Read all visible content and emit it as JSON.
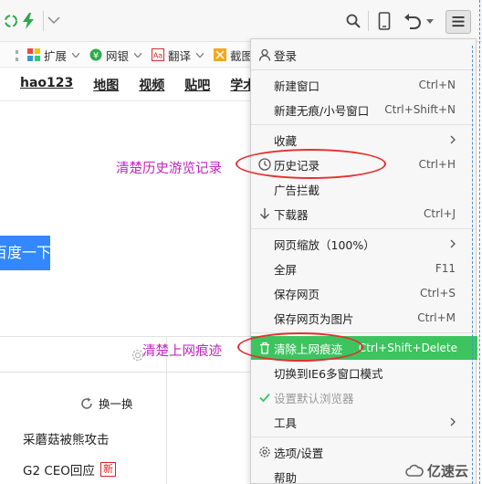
{
  "toolbar": {
    "refresh_icon": "refresh-icon",
    "accelerate_icon": "lightning-icon",
    "search_icon": "search-icon",
    "device_icon": "phone-icon",
    "undo_icon": "undo-icon",
    "menu_icon": "hamburger-menu-icon"
  },
  "bookmarks": [
    {
      "label": "扩展",
      "icon": "extension-icon"
    },
    {
      "label": "网银",
      "icon": "yen-icon"
    },
    {
      "label": "翻译",
      "icon": "translate-icon"
    },
    {
      "label": "截图",
      "icon": "screenshot-icon"
    }
  ],
  "nav": [
    "hao123",
    "地图",
    "视频",
    "贴吧",
    "学术"
  ],
  "search_button": "百度一下",
  "annotations": {
    "history": "清楚历史游览记录",
    "clear": "清楚上网痕迹"
  },
  "panel": {
    "refresh_label": "换一换",
    "news": [
      "采蘑菇被熊攻击",
      "G2 CEO回应"
    ],
    "new_badge": "新"
  },
  "menu": {
    "items": [
      {
        "key": "login",
        "label": "登录",
        "shortcut": ""
      },
      {
        "key": "new_window",
        "label": "新建窗口",
        "shortcut": "Ctrl+N"
      },
      {
        "key": "new_incognito",
        "label": "新建无痕/小号窗口",
        "shortcut": "Ctrl+Shift+N"
      },
      {
        "key": "favorites",
        "label": "收藏",
        "shortcut": ""
      },
      {
        "key": "history",
        "label": "历史记录",
        "shortcut": "Ctrl+H"
      },
      {
        "key": "adblock",
        "label": "广告拦截",
        "shortcut": ""
      },
      {
        "key": "downloads",
        "label": "下载器",
        "shortcut": "Ctrl+J"
      },
      {
        "key": "zoom",
        "label": "网页缩放（100%）",
        "shortcut": ""
      },
      {
        "key": "fullscreen",
        "label": "全屏",
        "shortcut": "F11"
      },
      {
        "key": "save_page",
        "label": "保存网页",
        "shortcut": "Ctrl+S"
      },
      {
        "key": "save_image",
        "label": "保存网页为图片",
        "shortcut": "Ctrl+M"
      },
      {
        "key": "clear_traces",
        "label": "清除上网痕迹",
        "shortcut": "Ctrl+Shift+Delete"
      },
      {
        "key": "ie6_mode",
        "label": "切换到IE6多窗口模式",
        "shortcut": ""
      },
      {
        "key": "default_browser",
        "label": "设置默认浏览器",
        "shortcut": ""
      },
      {
        "key": "tools",
        "label": "工具",
        "shortcut": ""
      },
      {
        "key": "options",
        "label": "选项/设置",
        "shortcut": ""
      },
      {
        "key": "help",
        "label": "帮助",
        "shortcut": ""
      }
    ]
  },
  "watermark": "亿速云",
  "colors": {
    "highlight": "#3dc45f",
    "annotation": "#c024c0",
    "ellipse": "#e53030",
    "search_button": "#3388ff"
  }
}
